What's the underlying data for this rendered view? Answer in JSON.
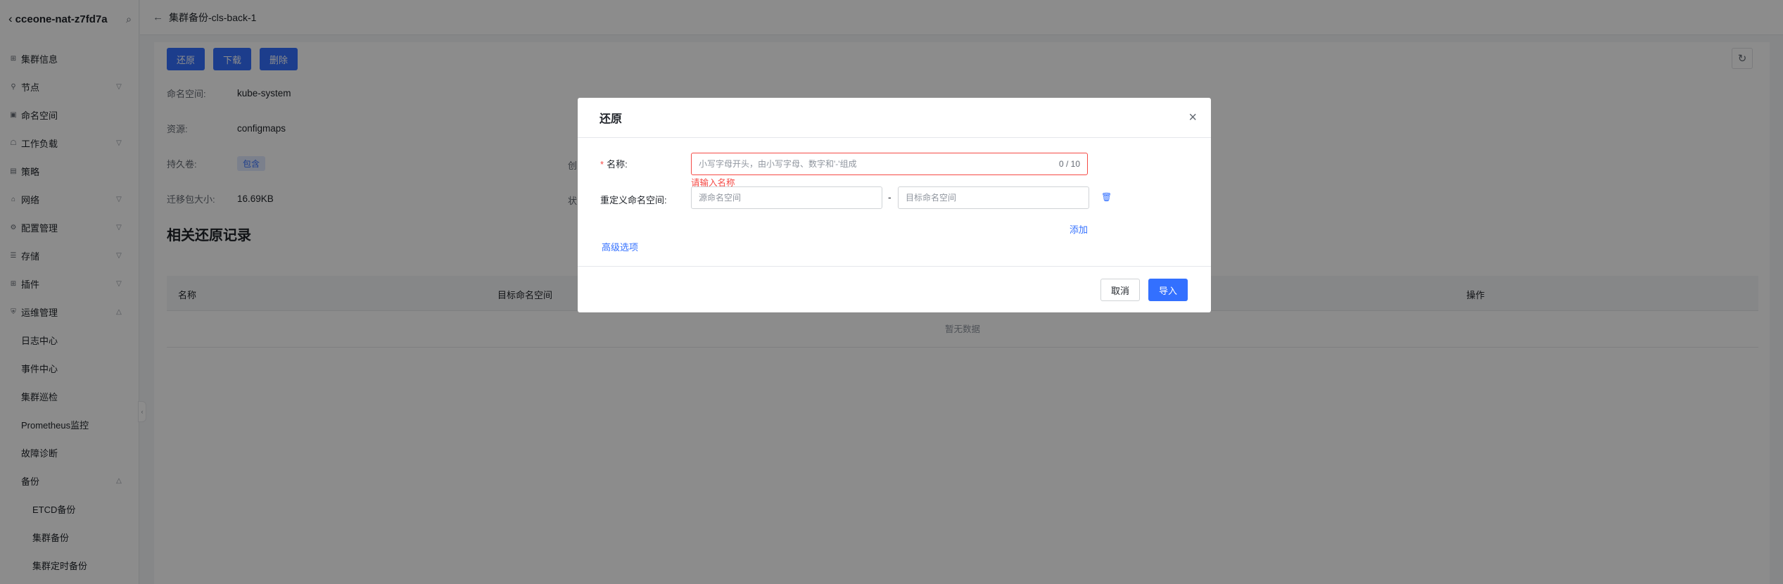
{
  "sidebar": {
    "cluster_name": "cceone-nat-z7fd7a",
    "back_icon": "chevron-left-icon",
    "search_icon": "search-icon",
    "items": [
      {
        "label": "集群信息",
        "icon": "cluster-info-icon"
      },
      {
        "label": "节点",
        "icon": "node-icon"
      },
      {
        "label": "命名空间",
        "icon": "namespace-icon"
      },
      {
        "label": "工作负载",
        "icon": "workload-icon"
      },
      {
        "label": "策略",
        "icon": "policy-icon"
      },
      {
        "label": "网络",
        "icon": "network-icon"
      },
      {
        "label": "配置管理",
        "icon": "config-icon"
      },
      {
        "label": "存储",
        "icon": "storage-icon"
      },
      {
        "label": "插件",
        "icon": "plugin-icon"
      },
      {
        "label": "运维管理",
        "icon": "ops-icon"
      },
      {
        "label": "日志中心"
      },
      {
        "label": "事件中心"
      },
      {
        "label": "集群巡检"
      },
      {
        "label": "Prometheus监控"
      },
      {
        "label": "故障诊断"
      },
      {
        "label": "备份"
      },
      {
        "label": "ETCD备份"
      },
      {
        "label": "集群备份"
      },
      {
        "label": "集群定时备份"
      }
    ]
  },
  "header": {
    "title": "集群备份-cls-back-1"
  },
  "toolbar": {
    "restore_label": "还原",
    "download_label": "下载",
    "delete_label": "删除"
  },
  "details": {
    "namespace_label": "命名空间:",
    "namespace_value": "kube-system",
    "resource_label": "资源:",
    "resource_value": "configmaps",
    "pv_label": "持久卷:",
    "pv_value": "包含",
    "size_label": "迁移包大小:",
    "size_value": "16.69KB",
    "clipped_1": "创",
    "clipped_2": "状"
  },
  "records": {
    "title": "相关还原记录",
    "columns": [
      "名称",
      "目标命名空间",
      "操作"
    ],
    "empty_text": "暂无数据"
  },
  "modal": {
    "title": "还原",
    "name_label": "名称:",
    "name_placeholder": "小写字母开头，由小写字母、数字和'-'组成",
    "name_value": "",
    "name_counter": "0 / 10",
    "name_error": "请输入名称",
    "ns_label": "重定义命名空间:",
    "source_ns_placeholder": "源命名空间",
    "target_ns_placeholder": "目标命名空间",
    "separator": "-",
    "add_label": "添加",
    "advanced_label": "高级选项",
    "cancel_label": "取消",
    "import_label": "导入"
  },
  "colors": {
    "primary": "#3370ff",
    "error": "#f54a45",
    "overlay": "rgba(0,0,0,0.45)"
  }
}
